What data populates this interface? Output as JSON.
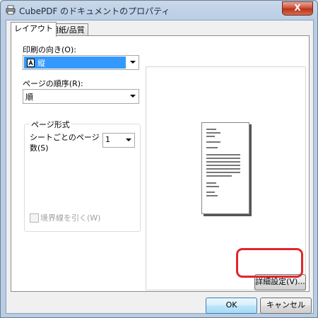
{
  "window": {
    "title": "CubePDF のドキュメントのプロパティ",
    "close_label": "X"
  },
  "tabs": [
    {
      "label": "レイアウト"
    },
    {
      "label": "用紙/品質"
    }
  ],
  "layout": {
    "orientation_label": "印刷の向き(O):",
    "orientation_value": "縦",
    "page_order_label": "ページの順序(R):",
    "page_order_value": "順",
    "page_format_group": "ページ形式",
    "pages_per_sheet_label_1": "シートごとのページ",
    "pages_per_sheet_label_2": "数(S)",
    "pages_per_sheet_value": "1",
    "border_checkbox_label": "境界線を引く(W)",
    "advanced_button": "詳細設定(V)..."
  },
  "buttons": {
    "ok": "OK",
    "cancel": "キャンセル"
  },
  "colors": {
    "selection": "#3399ff",
    "highlight_ring": "#e0262d"
  }
}
